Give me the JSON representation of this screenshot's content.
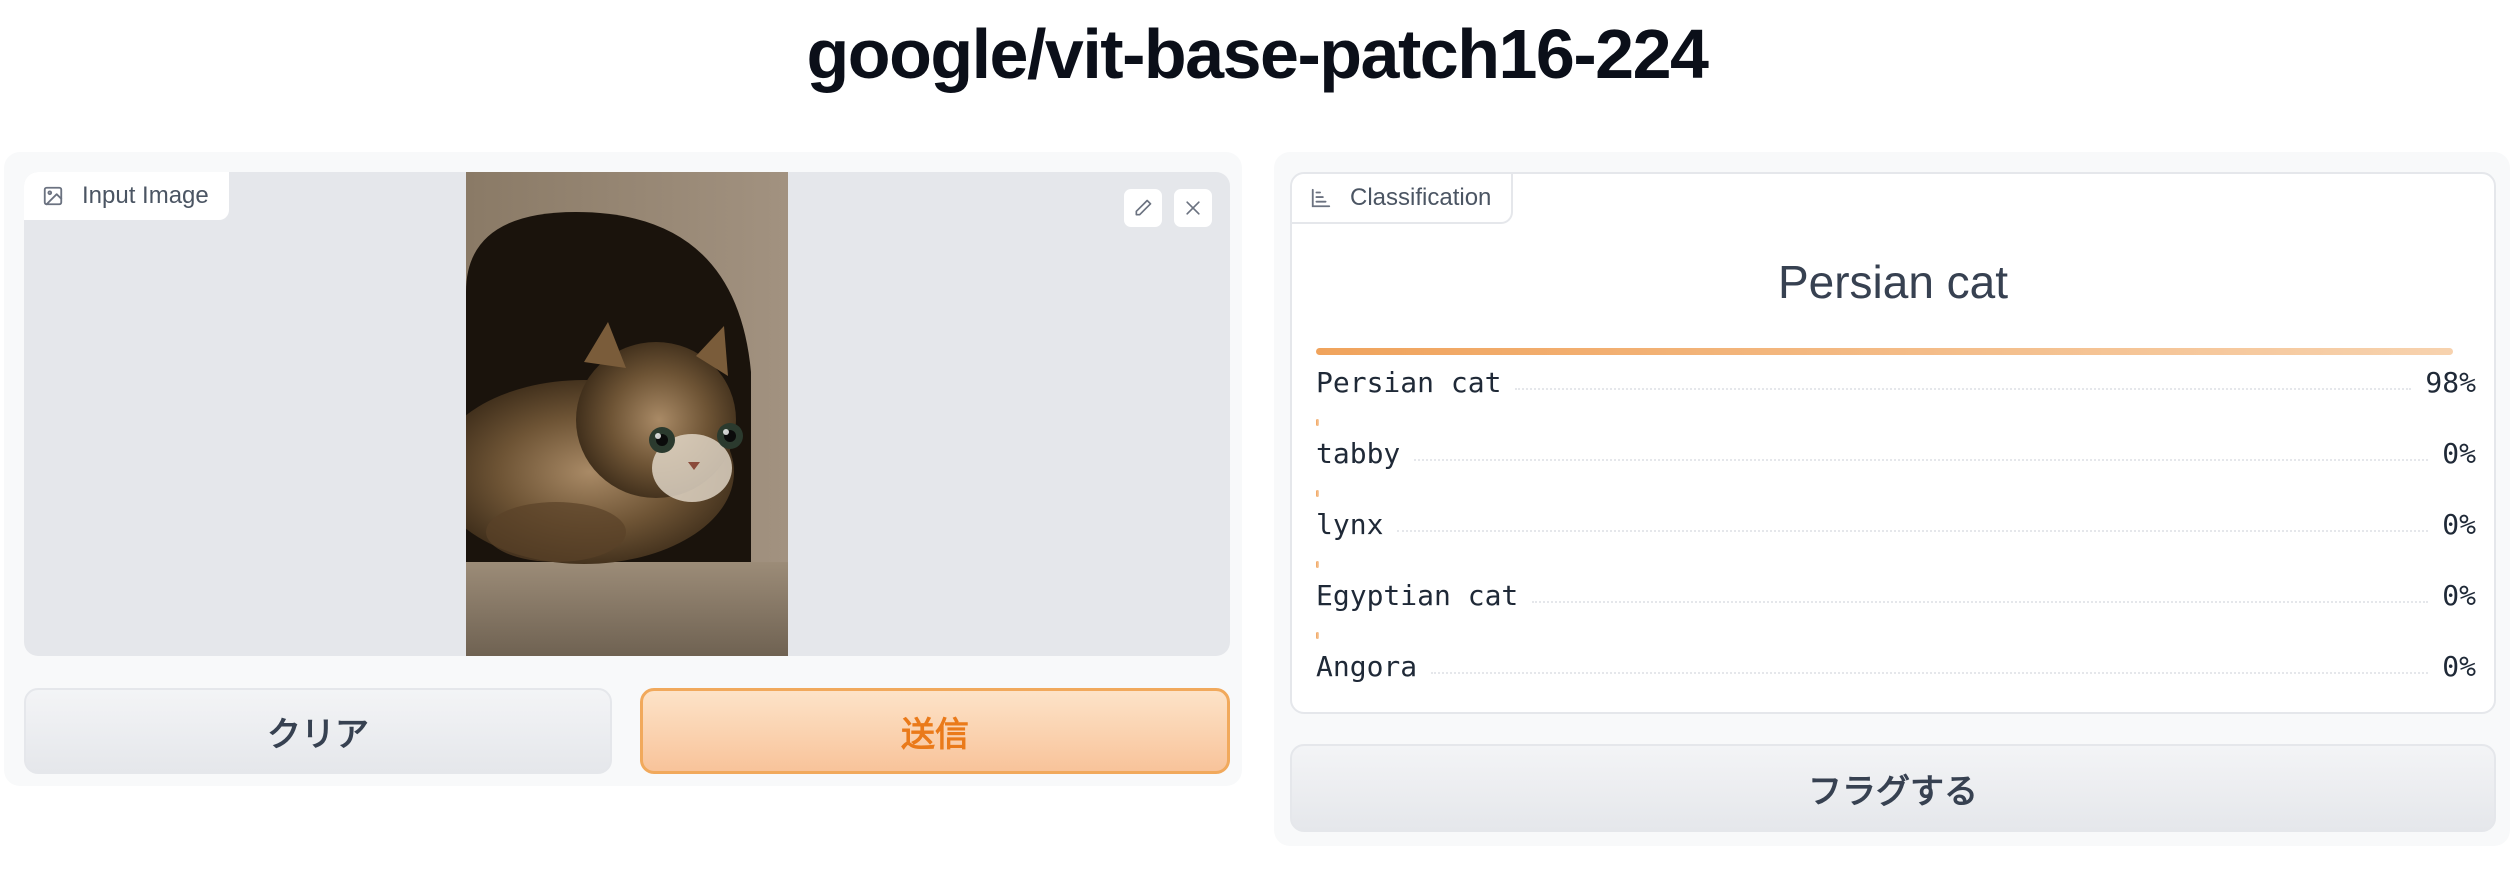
{
  "page": {
    "title": "google/vit-base-patch16-224"
  },
  "input": {
    "label": "Input Image",
    "label_icon": "image-icon",
    "edit_icon": "pencil-icon",
    "close_icon": "close-icon"
  },
  "buttons": {
    "clear": "クリア",
    "submit": "送信",
    "flag": "フラグする"
  },
  "output": {
    "label": "Classification",
    "label_icon": "bar-chart-icon",
    "top_label": "Persian cat",
    "results": [
      {
        "label": "Persian cat",
        "value": "98%",
        "confidence": 0.98
      },
      {
        "label": "tabby",
        "value": "0%",
        "confidence": 0.0
      },
      {
        "label": "lynx",
        "value": "0%",
        "confidence": 0.0
      },
      {
        "label": "Egyptian cat",
        "value": "0%",
        "confidence": 0.0
      },
      {
        "label": "Angora",
        "value": "0%",
        "confidence": 0.0
      }
    ]
  },
  "colors": {
    "accent": "#f0a35c",
    "accent_text": "#ea7a1a",
    "panel_bg": "#f8f9fa"
  }
}
